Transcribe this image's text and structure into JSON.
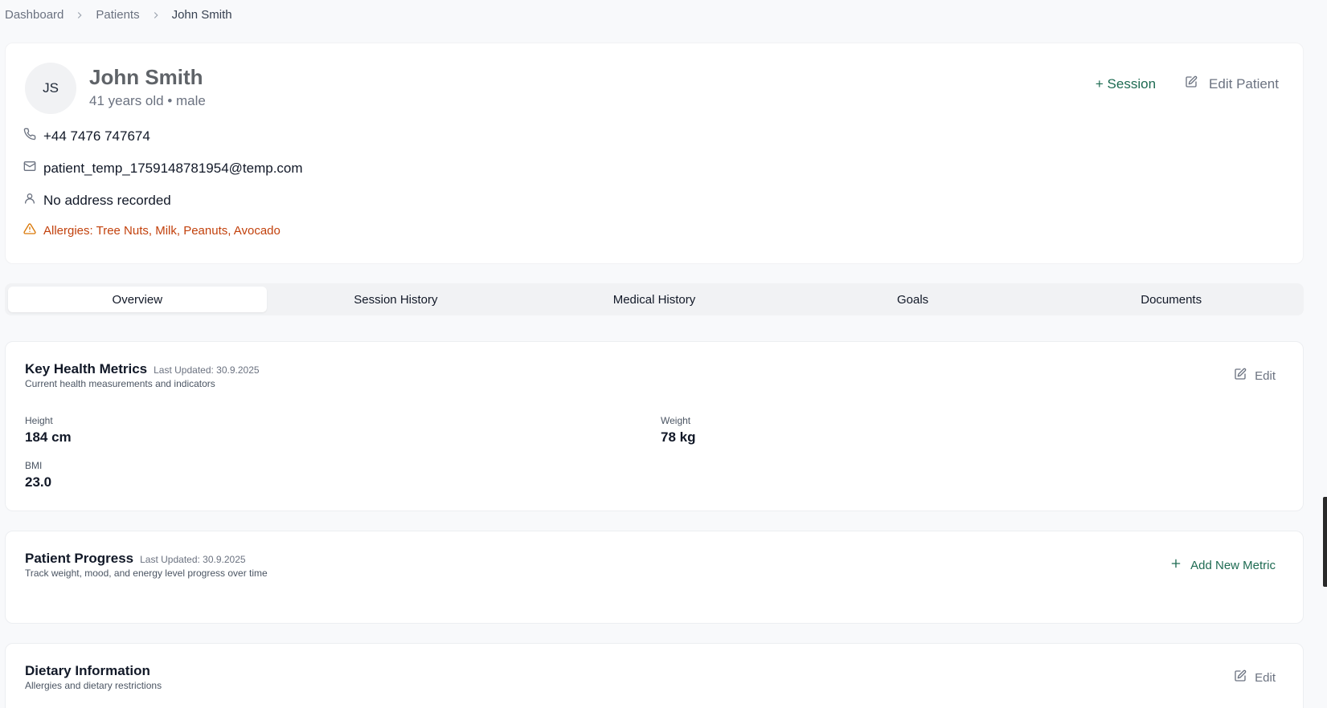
{
  "breadcrumb": {
    "items": [
      "Dashboard",
      "Patients",
      "John Smith"
    ]
  },
  "patient": {
    "initials": "JS",
    "name": "John Smith",
    "subtitle": "41 years old • male",
    "phone": "+44 7476 747674",
    "email": "patient_temp_1759148781954@temp.com",
    "address": "No address recorded",
    "allergies": "Allergies: Tree Nuts, Milk, Peanuts, Avocado"
  },
  "actions": {
    "session_label": "+ Session",
    "edit_patient_label": "Edit Patient"
  },
  "tabs": [
    {
      "label": "Overview",
      "active": true
    },
    {
      "label": "Session History",
      "active": false
    },
    {
      "label": "Medical History",
      "active": false
    },
    {
      "label": "Goals",
      "active": false
    },
    {
      "label": "Documents",
      "active": false
    }
  ],
  "metrics_card": {
    "title": "Key Health Metrics",
    "updated": "Last Updated: 30.9.2025",
    "description": "Current health measurements and indicators",
    "edit_label": "Edit",
    "metrics": [
      {
        "label": "Height",
        "value": "184 cm"
      },
      {
        "label": "Weight",
        "value": "78 kg"
      },
      {
        "label": "BMI",
        "value": "23.0"
      }
    ]
  },
  "progress_card": {
    "title": "Patient Progress",
    "updated": "Last Updated: 30.9.2025",
    "description": "Track weight, mood, and energy level progress over time",
    "add_label": "Add New Metric"
  },
  "diet_card": {
    "title": "Dietary Information",
    "description": "Allergies and dietary restrictions",
    "edit_label": "Edit"
  },
  "colors": {
    "accent": "#1e6b52",
    "warning": "#c2410c",
    "muted": "#6b7280"
  }
}
